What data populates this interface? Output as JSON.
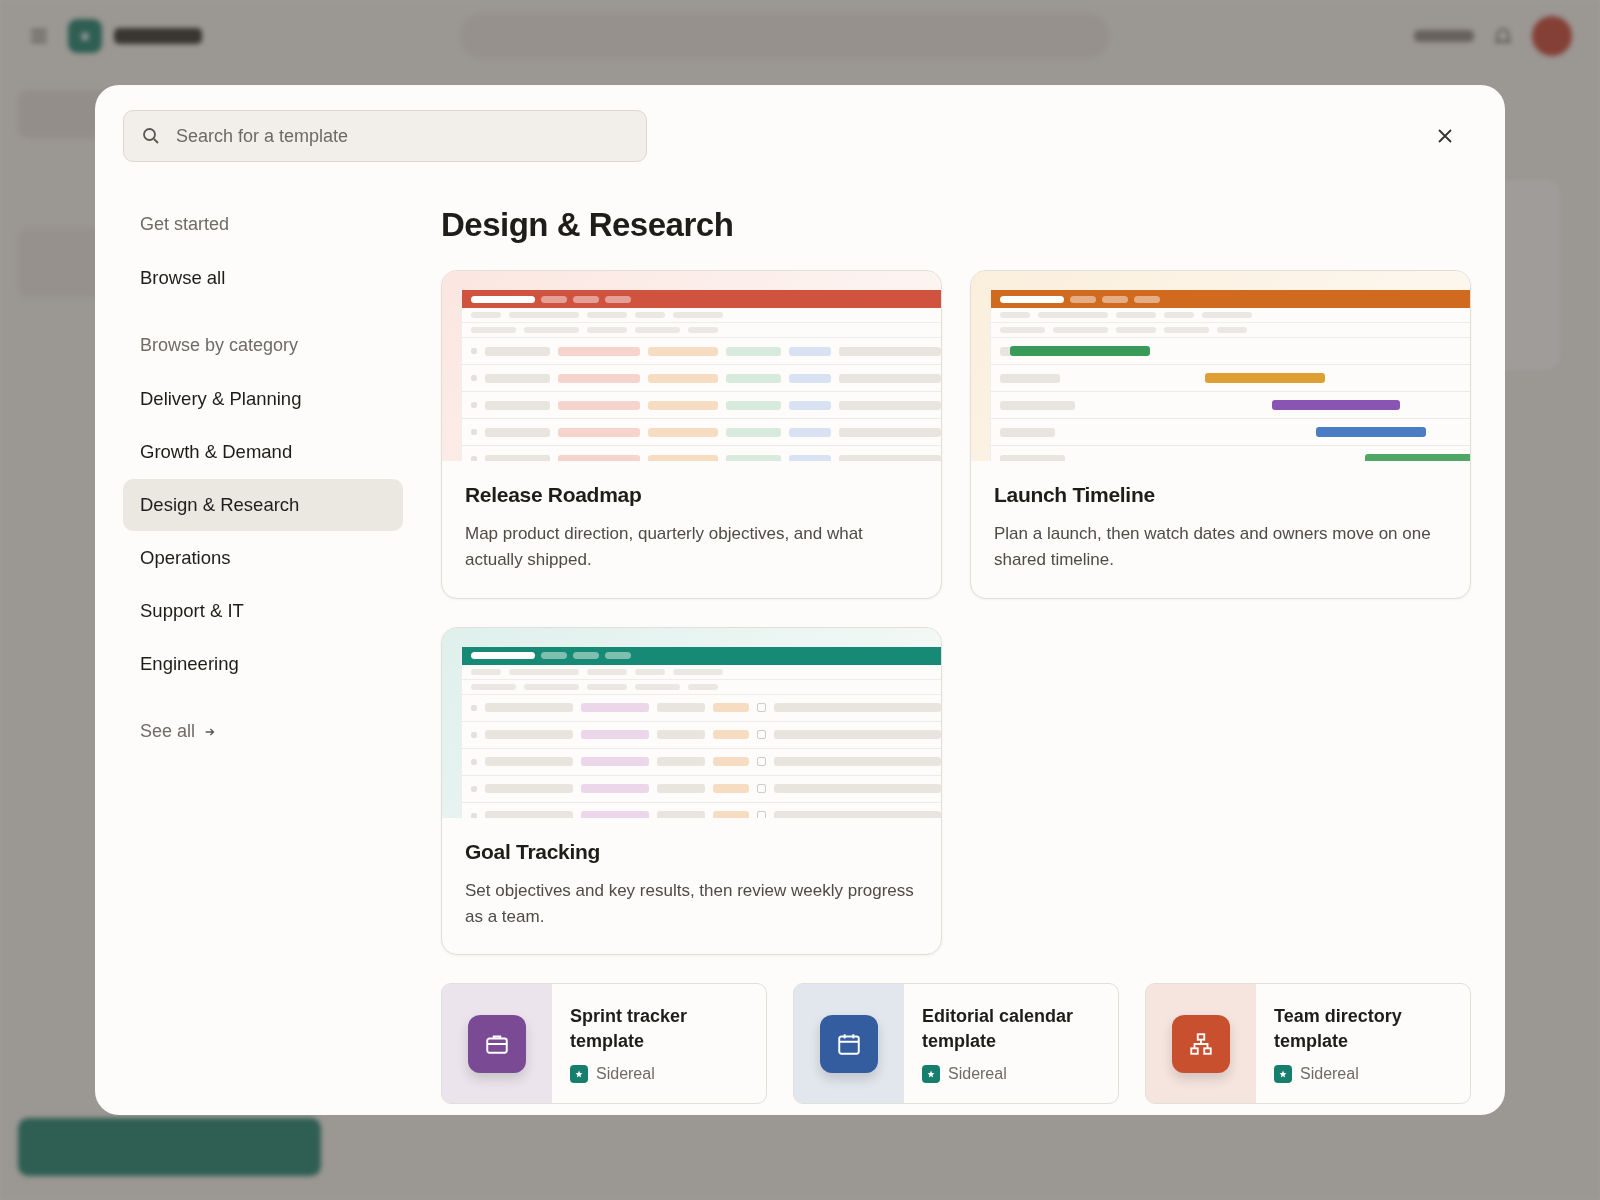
{
  "modal": {
    "search": {
      "placeholder": "Search for a template"
    },
    "nav": [
      {
        "heading": "Get started",
        "items": [
          {
            "label": "Browse all",
            "selected": false
          }
        ]
      },
      {
        "heading": "Browse by category",
        "items": [
          {
            "label": "Delivery & Planning",
            "selected": false
          },
          {
            "label": "Growth & Demand",
            "selected": false
          },
          {
            "label": "Design & Research",
            "selected": true
          },
          {
            "label": "Operations",
            "selected": false
          },
          {
            "label": "Support & IT",
            "selected": false
          },
          {
            "label": "Engineering",
            "selected": false
          }
        ]
      }
    ],
    "see_all": "See all",
    "title": "Design & Research",
    "featured": [
      {
        "title": "Release Roadmap",
        "description": "Map product direction, quarterly objectives, and what actually shipped.",
        "kind": "table",
        "color": "#d0533f"
      },
      {
        "title": "Launch Timeline",
        "description": "Plan a launch, then watch dates and owners move on one shared timeline.",
        "kind": "timeline",
        "color": "#cf6a1e"
      },
      {
        "title": "Goal Tracking",
        "description": "Set objectives and key results, then review weekly progress as a team.",
        "kind": "checklist",
        "color": "#168a74"
      }
    ],
    "templates": [
      {
        "title": "Sprint tracker template",
        "kind": "briefcase",
        "color": "#7b4a94",
        "source": "Sidereal"
      },
      {
        "title": "Editorial calendar template",
        "kind": "calendar",
        "color": "#335d9e",
        "source": "Sidereal"
      },
      {
        "title": "Team directory template",
        "kind": "org-chart",
        "color": "#c8502e",
        "source": "Sidereal"
      }
    ]
  }
}
